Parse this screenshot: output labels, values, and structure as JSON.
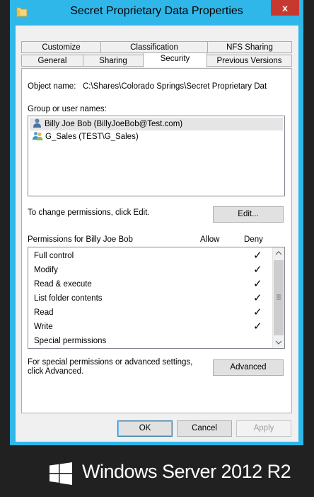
{
  "window": {
    "title": "Secret Proprietary Data Properties",
    "close_glyph": "x"
  },
  "tabs_top": [
    "Customize",
    "Classification",
    "NFS Sharing"
  ],
  "tabs_bottom": [
    "General",
    "Sharing",
    "Security",
    "Previous Versions"
  ],
  "security": {
    "object_name_label": "Object name:",
    "object_name_value": "C:\\Shares\\Colorado Springs\\Secret Proprietary Dat",
    "groups_label": "Group or user names:",
    "users": [
      {
        "name": "Billy Joe Bob (BillyJoeBob@Test.com)",
        "icon": "user-icon"
      },
      {
        "name": "G_Sales (TEST\\G_Sales)",
        "icon": "group-icon"
      }
    ],
    "change_hint": "To change permissions, click Edit.",
    "edit_label": "Edit...",
    "permissions_label": "Permissions for Billy Joe Bob",
    "allow_header": "Allow",
    "deny_header": "Deny",
    "permissions": [
      {
        "name": "Full control",
        "deny": "✓"
      },
      {
        "name": "Modify",
        "deny": "✓"
      },
      {
        "name": "Read & execute",
        "deny": "✓"
      },
      {
        "name": "List folder contents",
        "deny": "✓"
      },
      {
        "name": "Read",
        "deny": "✓"
      },
      {
        "name": "Write",
        "deny": "✓"
      },
      {
        "name": "Special permissions",
        "deny": ""
      }
    ],
    "advanced_hint_1": "For special permissions or advanced settings,",
    "advanced_hint_2": "click Advanced.",
    "advanced_label": "Advanced"
  },
  "footer": {
    "ok": "OK",
    "cancel": "Cancel",
    "apply": "Apply"
  },
  "branding": {
    "text": "Windows Server 2012 R2"
  },
  "colors": {
    "titlebar": "#2fb7e9",
    "close": "#c7392e",
    "background": "#212121"
  }
}
